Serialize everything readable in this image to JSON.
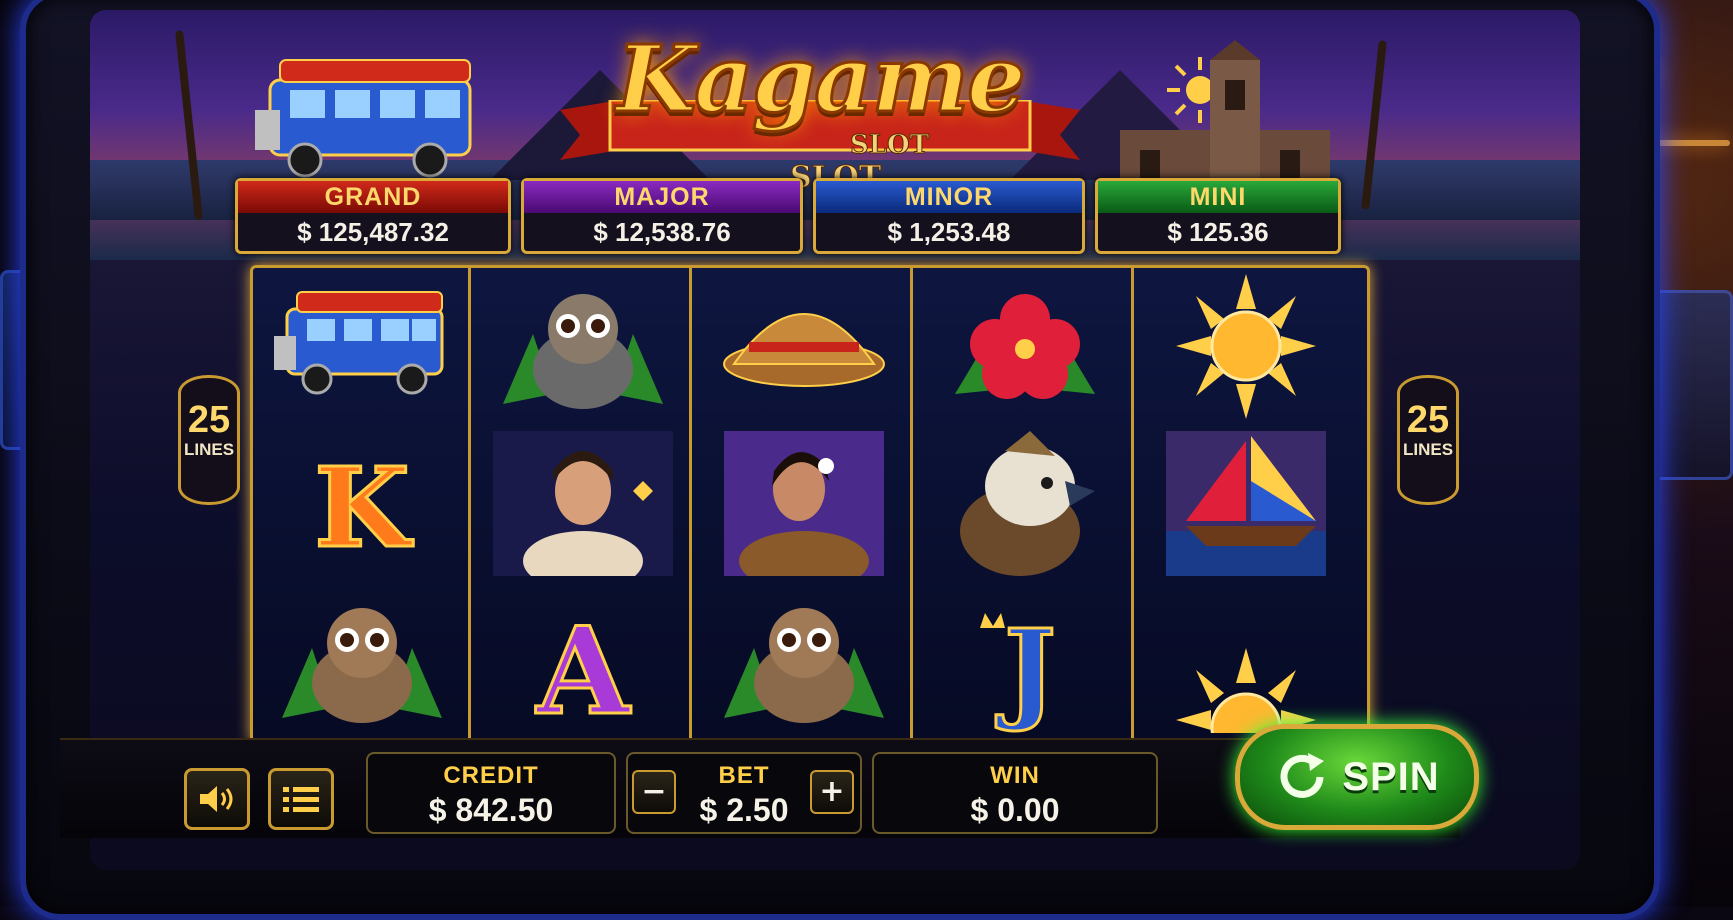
{
  "game": {
    "title": "Kagame",
    "subtitle_1": "SLOT",
    "subtitle_2": "SLOT"
  },
  "jackpots": [
    {
      "name": "GRAND",
      "value": "$ 125,487.32",
      "color": "#d02a1a"
    },
    {
      "name": "MAJOR",
      "value": "$ 12,538.76",
      "color": "#8a2ac0"
    },
    {
      "name": "MINOR",
      "value": "$ 1,253.48",
      "color": "#2a5ad0"
    },
    {
      "name": "MINI",
      "value": "$ 125.36",
      "color": "#2aa83a"
    }
  ],
  "paylines": {
    "count": "25",
    "label": "LINES"
  },
  "reels": [
    [
      "jeepney-icon",
      "letter-k-icon",
      "tarsier-icon"
    ],
    [
      "tarsier-icon",
      "filipina-woman-icon",
      "letter-a-icon"
    ],
    [
      "salakot-hat-icon",
      "filipina-woman-icon",
      "tarsier-icon"
    ],
    [
      "hibiscus-icon",
      "philippine-eagle-icon",
      "letter-j-icon"
    ],
    [
      "sun-icon",
      "sailboat-icon",
      "sun-icon"
    ]
  ],
  "reel_letters": {
    "k": "K",
    "a": "A",
    "j": "J"
  },
  "controls": {
    "credit_label": "CREDIT",
    "credit_value": "$ 842.50",
    "bet_label": "BET",
    "bet_value": "$ 2.50",
    "bet_decrease": "−",
    "bet_increase": "+",
    "win_label": "WIN",
    "win_value": "$ 0.00",
    "spin_label": "SPIN",
    "sound_icon": "speaker-icon",
    "menu_icon": "menu-icon"
  },
  "colors": {
    "gold": "#d9a93a",
    "spin_green": "#1f8a1a",
    "cabinet_neon": "#2b45ff"
  }
}
